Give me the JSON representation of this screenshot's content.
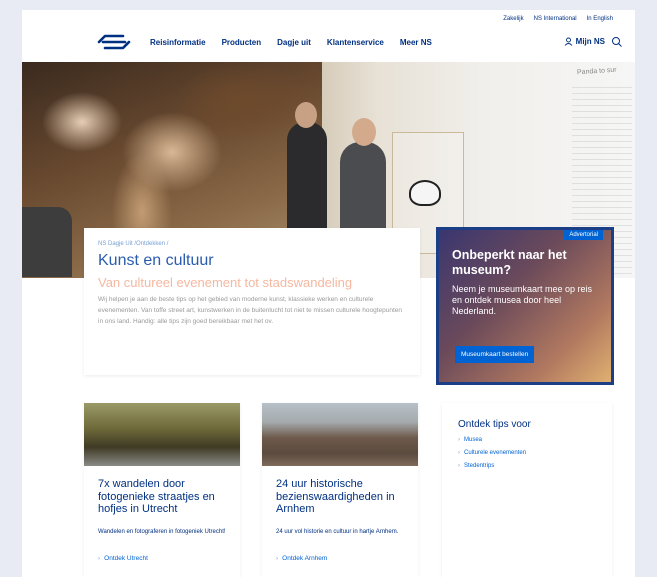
{
  "header": {
    "top_links": [
      "Zakelijk",
      "NS International",
      "In English"
    ],
    "nav": [
      "Reisinformatie",
      "Producten",
      "Dagje uit",
      "Klantenservice",
      "Meer NS"
    ],
    "account_label": "Mijn NS"
  },
  "hero": {
    "wall_sign": "Panda to sur"
  },
  "intro": {
    "breadcrumb": "NS Dagje Uit /Ontdekken /",
    "title": "Kunst en cultuur",
    "subtitle": "Van cultureel evenement tot stadswandeling",
    "text": "Wij helpen je aan de beste tips op het gebied van moderne kunst, klassieke werken en culturele evenementen. Van toffe street art, kunstwerken in de buitenlucht tot niet te missen culturele hoogtepunten in ons land. Handig: alle tips zijn goed bereikbaar met het ov."
  },
  "ad": {
    "badge": "Advertorial",
    "title": "Onbeperkt naar het museum?",
    "text": "Neem je museumkaart mee op reis en ontdek musea door heel Nederland.",
    "button": "Museumkaart bestellen"
  },
  "cards": [
    {
      "title": "7x wandelen door fotogenieke straatjes en hofjes in Utrecht",
      "desc": "Wandelen en fotograferen in fotogeniek Utrecht!",
      "link": "Ontdek Utrecht"
    },
    {
      "title": "24 uur historische bezienswaardigheden in Arnhem",
      "desc": "24 uur vol historie en cultuur in hartje Arnhem.",
      "link": "Ontdek Arnhem"
    }
  ],
  "tips": {
    "title": "Ontdek tips voor",
    "items": [
      "Musea",
      "Culturele evenementen",
      "Stedentrips"
    ]
  },
  "colors": {
    "brand_blue": "#003082",
    "link_blue": "#0063d3",
    "ad_border": "#1a3f86"
  }
}
